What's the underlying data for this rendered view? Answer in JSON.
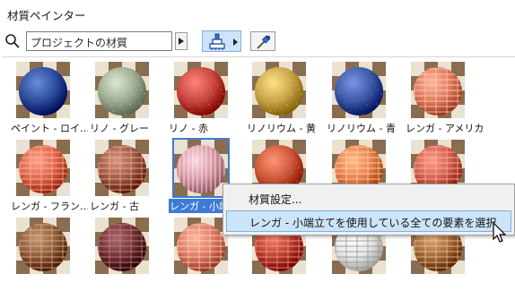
{
  "window": {
    "title": "材質ペインター"
  },
  "toolbar": {
    "search_value": "プロジェクトの材質",
    "icons": {
      "search": "search-icon",
      "brush": "paint-brush-icon",
      "picker": "eyedropper-icon"
    }
  },
  "materials": [
    {
      "label": "ペイント - ロイ…",
      "color": "#2d4f9e",
      "pattern": "plain"
    },
    {
      "label": "リノ - グレー",
      "color": "#9fad95",
      "pattern": "speckle"
    },
    {
      "label": "リノ - 赤",
      "color": "#c9483f",
      "pattern": "speckle"
    },
    {
      "label": "リノリウム - 黄",
      "color": "#c9a64a",
      "pattern": "speckle"
    },
    {
      "label": "リノリウム - 青",
      "color": "#3e59a8",
      "pattern": "speckle"
    },
    {
      "label": "レンガ - アメリカ…",
      "color": "#e07a5f",
      "pattern": "brick"
    },
    {
      "label": "レンガ - フラン…",
      "color": "#e0654e",
      "pattern": "brick"
    },
    {
      "label": "レンガ - 古",
      "color": "#9d5a44",
      "pattern": "brick"
    },
    {
      "label": "レンガ - 小端立",
      "color": "#d99aa6",
      "pattern": "stripe",
      "selected": true
    },
    {
      "label": "",
      "color": "#d0583a",
      "pattern": "speckle"
    },
    {
      "label": "",
      "color": "#e8804f",
      "pattern": "brick"
    },
    {
      "label": "",
      "color": "#d0604e",
      "pattern": "herring"
    },
    {
      "label": "",
      "color": "#8d5c3a",
      "pattern": "brick"
    },
    {
      "label": "",
      "color": "#6f2f33",
      "pattern": "brick"
    },
    {
      "label": "",
      "color": "#de7a64",
      "pattern": "brick"
    },
    {
      "label": "",
      "color": "#b9402f",
      "pattern": "brick"
    },
    {
      "label": "",
      "color": "#e9e9e9",
      "pattern": "brick"
    },
    {
      "label": "",
      "color": "#a06a3a",
      "pattern": "barrel"
    }
  ],
  "context_menu": {
    "items": [
      {
        "label": "材質設定..."
      },
      {
        "label": "レンガ - 小端立てを使用している全ての要素を選択",
        "highlighted": true
      }
    ]
  },
  "colors": {
    "selection": "#3e7cd4",
    "hover": "#cce4f7",
    "checker_light": "#e9e1d2",
    "checker_dark": "#8a6d4e"
  }
}
